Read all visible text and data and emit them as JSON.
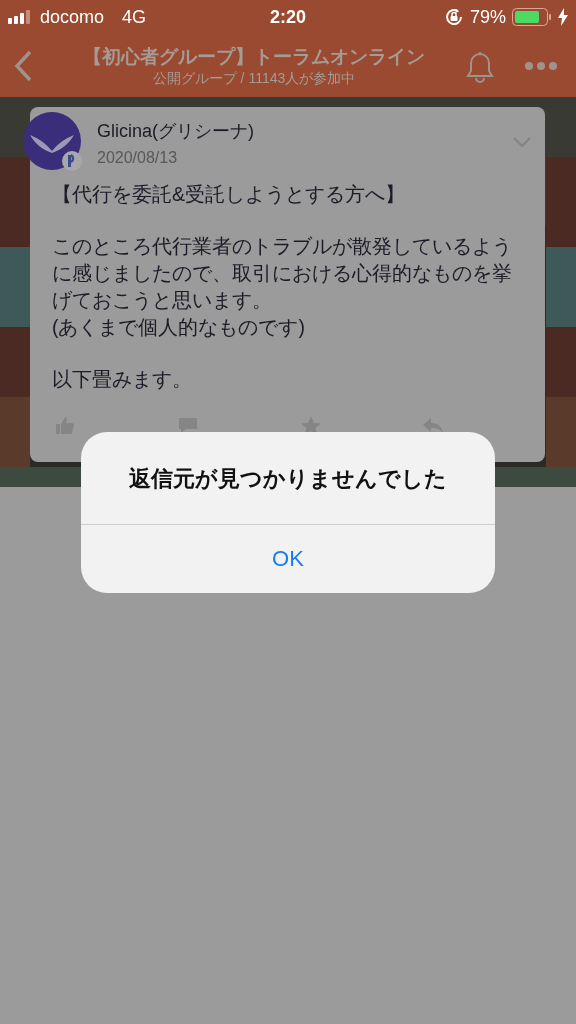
{
  "status_bar": {
    "carrier": "docomo",
    "network": "4G",
    "time": "2:20",
    "battery": "79%",
    "charging": true
  },
  "nav": {
    "title": "【初心者グループ】トーラムオンライン",
    "subtitle": "公開グループ / 11143人が参加中"
  },
  "post": {
    "author": "Glicina(グリシーナ)",
    "date": "2020/08/13",
    "paragraphs": [
      "【代行を委託&受託しようとする方へ】",
      "このところ代行業者のトラブルが散発しているように感じましたので、取引における心得的なものを挙げておこうと思います。\n(あくまで個人的なものです)",
      "以下畳みます。"
    ],
    "actions": [
      {
        "kind": "like"
      },
      {
        "kind": "comment"
      },
      {
        "kind": "star"
      },
      {
        "kind": "reply"
      }
    ]
  },
  "dialog": {
    "message": "返信元が見つかりませんでした",
    "button": "OK"
  }
}
